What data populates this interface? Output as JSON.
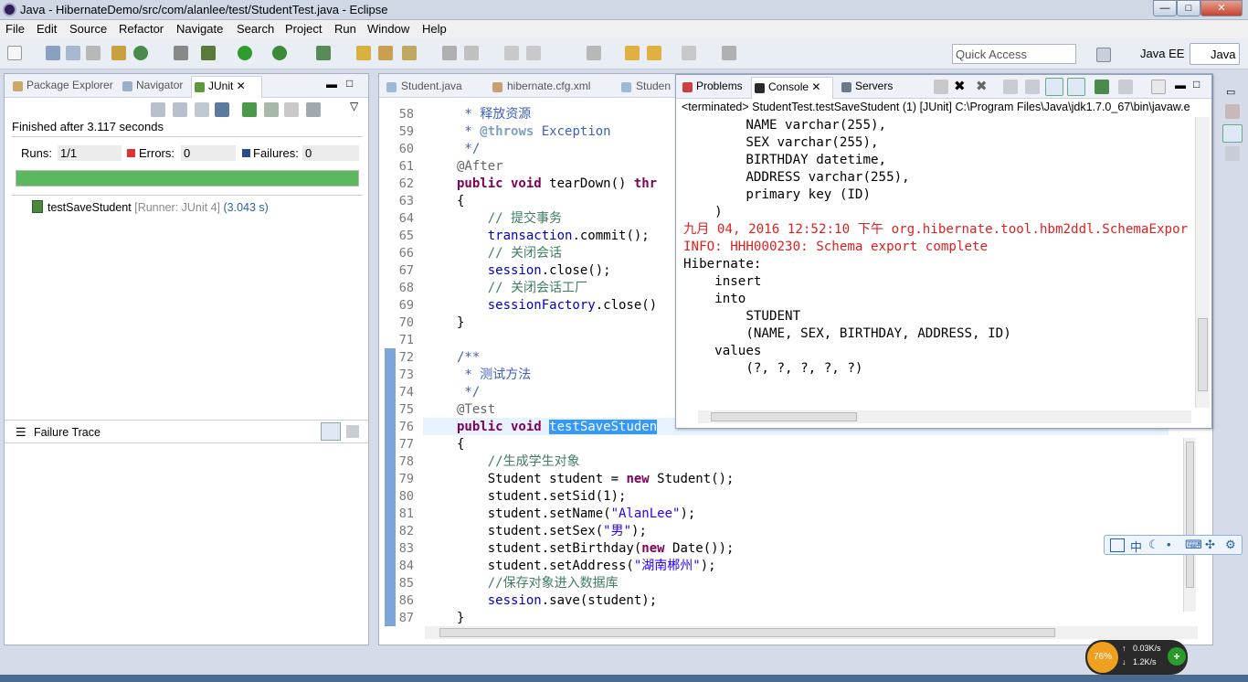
{
  "window": {
    "title": "Java - HibernateDemo/src/com/alanlee/test/StudentTest.java - Eclipse",
    "min": "—",
    "max": "□",
    "close": "✕"
  },
  "menu": [
    "File",
    "Edit",
    "Source",
    "Refactor",
    "Navigate",
    "Search",
    "Project",
    "Run",
    "Window",
    "Help"
  ],
  "toolbar": {
    "quick_access_placeholder": "Quick Access",
    "perspectives": [
      "Java EE",
      "Java"
    ]
  },
  "left": {
    "tabs": [
      "Package Explorer",
      "Navigator",
      "JUnit"
    ],
    "finished": "Finished after 3.117 seconds",
    "runs_label": "Runs:",
    "runs": "1/1",
    "errors_label": "Errors:",
    "errors": "0",
    "failures_label": "Failures:",
    "failures": "0",
    "test_name": "testSaveStudent",
    "test_runner": "[Runner: JUnit 4]",
    "test_time": "(3.043 s)",
    "failure_trace": "Failure Trace",
    "progress": 1.0,
    "progress_color": "#5cb85c"
  },
  "editor": {
    "tabs": [
      "Student.java",
      "hibernate.cfg.xml",
      "Studen"
    ],
    "line_numbers": [
      "58",
      "59",
      "60",
      "61",
      "62",
      "63",
      "64",
      "65",
      "66",
      "67",
      "68",
      "69",
      "70",
      "71",
      "72",
      "73",
      "74",
      "75",
      "76",
      "77",
      "78",
      "79",
      "80",
      "81",
      "82",
      "83",
      "84",
      "85",
      "86",
      "87"
    ],
    "lines": [
      {
        "t": "jd",
        "s": " * 释放资源"
      },
      {
        "t": "jt",
        "s": " * @throws Exception"
      },
      {
        "t": "jd",
        "s": " */"
      },
      {
        "t": "an",
        "s": "@After"
      },
      {
        "t": "mix",
        "a": "public void ",
        "b": "tearDown() thr"
      },
      {
        "t": "pl",
        "s": "{"
      },
      {
        "t": "cm",
        "s": "    // 提交事务"
      },
      {
        "t": "fdm",
        "a": "    transaction",
        ".": ".commit();"
      },
      {
        "t": "cm",
        "s": "    // 关闭会话"
      },
      {
        "t": "fdm",
        "a": "    session",
        ".": ".close();"
      },
      {
        "t": "cm",
        "s": "    // 关闭会话工厂"
      },
      {
        "t": "fdm",
        "a": "    sessionFactory",
        ".": ".close()"
      },
      {
        "t": "pl",
        "s": "}"
      },
      {
        "t": "pl",
        "s": ""
      },
      {
        "t": "jd",
        "s": "/**"
      },
      {
        "t": "jd",
        "s": " * 测试方法"
      },
      {
        "t": "jd",
        "s": " */"
      },
      {
        "t": "an",
        "s": "@Test"
      },
      {
        "t": "mix2",
        "a": "public void ",
        "b": "testSaveStuden"
      },
      {
        "t": "pl",
        "s": "{"
      },
      {
        "t": "cm",
        "s": "    //生成学生对象"
      },
      {
        "t": "new",
        "a": "    Student student = ",
        "b": "new",
        " c": " Student();"
      },
      {
        "t": "pl",
        "s": "    student.setSid(1);"
      },
      {
        "t": "str",
        "a": "    student.setName(",
        "b": "\"AlanLee\"",
        "c": ");"
      },
      {
        "t": "str",
        "a": "    student.setSex(",
        "b": "\"男\"",
        "c": ");"
      },
      {
        "t": "new",
        "a": "    student.setBirthday(",
        "b": "new",
        " c": " Date());"
      },
      {
        "t": "str",
        "a": "    student.setAddress(",
        "b": "\"湖南郴州\"",
        "c": ");"
      },
      {
        "t": "cm",
        "s": "    //保存对象进入数据库"
      },
      {
        "t": "fdm",
        "a": "    session",
        ".": ".save(student);"
      },
      {
        "t": "pl",
        "s": "}"
      }
    ]
  },
  "console": {
    "tabs": [
      "Problems",
      "Console",
      "Servers"
    ],
    "header": "<terminated> StudentTest.testSaveStudent (1) [JUnit] C:\\Program Files\\Java\\jdk1.7.0_67\\bin\\javaw.e",
    "lines": [
      {
        "red": false,
        "s": "        NAME varchar(255),"
      },
      {
        "red": false,
        "s": "        SEX varchar(255),"
      },
      {
        "red": false,
        "s": "        BIRTHDAY datetime,"
      },
      {
        "red": false,
        "s": "        ADDRESS varchar(255),"
      },
      {
        "red": false,
        "s": "        primary key (ID)"
      },
      {
        "red": false,
        "s": "    )"
      },
      {
        "red": true,
        "s": "九月 04, 2016 12:52:10 下午 org.hibernate.tool.hbm2ddl.SchemaExpor"
      },
      {
        "red": true,
        "s": "INFO: HHH000230: Schema export complete"
      },
      {
        "red": false,
        "s": "Hibernate:"
      },
      {
        "red": false,
        "s": "    insert"
      },
      {
        "red": false,
        "s": "    into"
      },
      {
        "red": false,
        "s": "        STUDENT"
      },
      {
        "red": false,
        "s": "        (NAME, SEX, BIRTHDAY, ADDRESS, ID)"
      },
      {
        "red": false,
        "s": "    values"
      },
      {
        "red": false,
        "s": "        (?, ?, ?, ?, ?)"
      }
    ]
  },
  "ime": {
    "label": "中"
  },
  "network": {
    "cpu": "76%",
    "up": "0.03K/s",
    "down": "1.2K/s"
  }
}
